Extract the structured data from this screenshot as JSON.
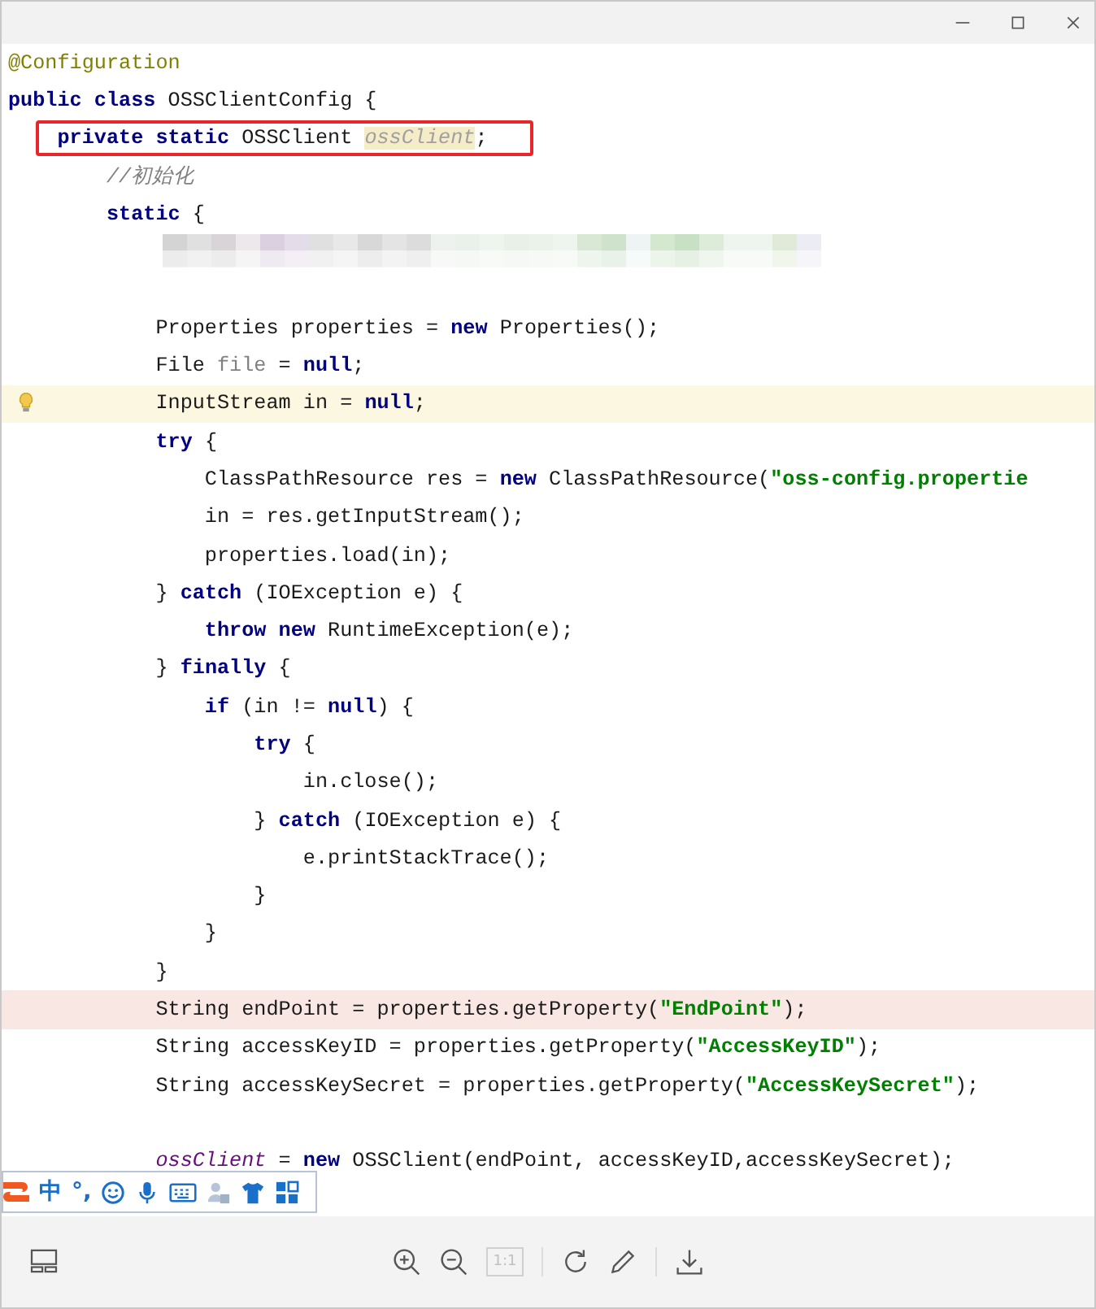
{
  "code_lines": [
    {
      "kind": "code",
      "caret_line": false,
      "error_line": false,
      "boxed": false,
      "bulb": false,
      "tokens": [
        {
          "kind": "annotation",
          "text": "@Configuration"
        }
      ]
    },
    {
      "kind": "code",
      "caret_line": false,
      "error_line": false,
      "boxed": false,
      "bulb": false,
      "tokens": [
        {
          "kind": "keyword",
          "text": "public class"
        },
        {
          "kind": "plain",
          "text": " OSSClientConfig {"
        }
      ]
    },
    {
      "kind": "code",
      "caret_line": false,
      "error_line": false,
      "boxed": true,
      "bulb": false,
      "tokens": [
        {
          "kind": "keyword",
          "text": "    private static"
        },
        {
          "kind": "plain",
          "text": " OSSClient "
        },
        {
          "kind": "unused_field",
          "text": "ossClient"
        },
        {
          "kind": "plain",
          "text": ";"
        }
      ]
    },
    {
      "kind": "code",
      "caret_line": false,
      "error_line": false,
      "boxed": false,
      "bulb": false,
      "tokens": [
        {
          "kind": "comment",
          "text": "        //初始化"
        }
      ]
    },
    {
      "kind": "code",
      "caret_line": false,
      "error_line": false,
      "boxed": false,
      "bulb": false,
      "tokens": [
        {
          "kind": "keyword",
          "text": "        static"
        },
        {
          "kind": "plain",
          "text": " {"
        }
      ]
    },
    {
      "kind": "blurred",
      "caret_line": false,
      "error_line": false,
      "boxed": false,
      "bulb": false
    },
    {
      "kind": "blank",
      "caret_line": false,
      "error_line": false,
      "boxed": false,
      "bulb": false
    },
    {
      "kind": "code",
      "caret_line": false,
      "error_line": false,
      "boxed": false,
      "bulb": false,
      "tokens": [
        {
          "kind": "plain",
          "text": "            Properties properties = "
        },
        {
          "kind": "keyword",
          "text": "new"
        },
        {
          "kind": "plain",
          "text": " Properties();"
        }
      ]
    },
    {
      "kind": "code",
      "caret_line": false,
      "error_line": false,
      "boxed": false,
      "bulb": false,
      "tokens": [
        {
          "kind": "plain",
          "text": "            File "
        },
        {
          "kind": "unused",
          "text": "file"
        },
        {
          "kind": "plain",
          "text": " = "
        },
        {
          "kind": "keyword",
          "text": "null"
        },
        {
          "kind": "plain",
          "text": ";"
        }
      ]
    },
    {
      "kind": "code",
      "caret_line": true,
      "error_line": false,
      "boxed": false,
      "bulb": true,
      "tokens": [
        {
          "kind": "plain",
          "text": "            InputStream in = "
        },
        {
          "kind": "keyword",
          "text": "null"
        },
        {
          "kind": "plain",
          "text": ";"
        }
      ]
    },
    {
      "kind": "code",
      "caret_line": false,
      "error_line": false,
      "boxed": false,
      "bulb": false,
      "tokens": [
        {
          "kind": "keyword",
          "text": "            try"
        },
        {
          "kind": "plain",
          "text": " {"
        }
      ]
    },
    {
      "kind": "code",
      "caret_line": false,
      "error_line": false,
      "boxed": false,
      "bulb": false,
      "tokens": [
        {
          "kind": "plain",
          "text": "                ClassPathResource res = "
        },
        {
          "kind": "keyword",
          "text": "new"
        },
        {
          "kind": "plain",
          "text": " ClassPathResource("
        },
        {
          "kind": "string",
          "text": "\"oss-config.propertie"
        }
      ]
    },
    {
      "kind": "code",
      "caret_line": false,
      "error_line": false,
      "boxed": false,
      "bulb": false,
      "tokens": [
        {
          "kind": "plain",
          "text": "                in = res.getInputStream();"
        }
      ]
    },
    {
      "kind": "code",
      "caret_line": false,
      "error_line": false,
      "boxed": false,
      "bulb": false,
      "tokens": [
        {
          "kind": "plain",
          "text": "                properties.load(in);"
        }
      ]
    },
    {
      "kind": "code",
      "caret_line": false,
      "error_line": false,
      "boxed": false,
      "bulb": false,
      "tokens": [
        {
          "kind": "plain",
          "text": "            } "
        },
        {
          "kind": "keyword",
          "text": "catch"
        },
        {
          "kind": "plain",
          "text": " (IOException e) {"
        }
      ]
    },
    {
      "kind": "code",
      "caret_line": false,
      "error_line": false,
      "boxed": false,
      "bulb": false,
      "tokens": [
        {
          "kind": "keyword",
          "text": "                throw new"
        },
        {
          "kind": "plain",
          "text": " RuntimeException(e);"
        }
      ]
    },
    {
      "kind": "code",
      "caret_line": false,
      "error_line": false,
      "boxed": false,
      "bulb": false,
      "tokens": [
        {
          "kind": "plain",
          "text": "            } "
        },
        {
          "kind": "keyword",
          "text": "finally"
        },
        {
          "kind": "plain",
          "text": " {"
        }
      ]
    },
    {
      "kind": "code",
      "caret_line": false,
      "error_line": false,
      "boxed": false,
      "bulb": false,
      "tokens": [
        {
          "kind": "keyword",
          "text": "                if"
        },
        {
          "kind": "plain",
          "text": " (in != "
        },
        {
          "kind": "keyword",
          "text": "null"
        },
        {
          "kind": "plain",
          "text": ") {"
        }
      ]
    },
    {
      "kind": "code",
      "caret_line": false,
      "error_line": false,
      "boxed": false,
      "bulb": false,
      "tokens": [
        {
          "kind": "keyword",
          "text": "                    try"
        },
        {
          "kind": "plain",
          "text": " {"
        }
      ]
    },
    {
      "kind": "code",
      "caret_line": false,
      "error_line": false,
      "boxed": false,
      "bulb": false,
      "tokens": [
        {
          "kind": "plain",
          "text": "                        in.close();"
        }
      ]
    },
    {
      "kind": "code",
      "caret_line": false,
      "error_line": false,
      "boxed": false,
      "bulb": false,
      "tokens": [
        {
          "kind": "plain",
          "text": "                    } "
        },
        {
          "kind": "keyword",
          "text": "catch"
        },
        {
          "kind": "plain",
          "text": " (IOException e) {"
        }
      ]
    },
    {
      "kind": "code",
      "caret_line": false,
      "error_line": false,
      "boxed": false,
      "bulb": false,
      "tokens": [
        {
          "kind": "plain",
          "text": "                        e.printStackTrace();"
        }
      ]
    },
    {
      "kind": "code",
      "caret_line": false,
      "error_line": false,
      "boxed": false,
      "bulb": false,
      "tokens": [
        {
          "kind": "plain",
          "text": "                    }"
        }
      ]
    },
    {
      "kind": "code",
      "caret_line": false,
      "error_line": false,
      "boxed": false,
      "bulb": false,
      "tokens": [
        {
          "kind": "plain",
          "text": "                }"
        }
      ]
    },
    {
      "kind": "code",
      "caret_line": false,
      "error_line": false,
      "boxed": false,
      "bulb": false,
      "tokens": [
        {
          "kind": "plain",
          "text": "            }"
        }
      ]
    },
    {
      "kind": "code",
      "caret_line": false,
      "error_line": true,
      "boxed": false,
      "bulb": false,
      "tokens": [
        {
          "kind": "plain",
          "text": "            String endPoint = properties.getProperty("
        },
        {
          "kind": "string",
          "text": "\"EndPoint\""
        },
        {
          "kind": "plain",
          "text": ");"
        }
      ]
    },
    {
      "kind": "code",
      "caret_line": false,
      "error_line": false,
      "boxed": false,
      "bulb": false,
      "tokens": [
        {
          "kind": "plain",
          "text": "            String accessKeyID = properties.getProperty("
        },
        {
          "kind": "string",
          "text": "\"AccessKeyID\""
        },
        {
          "kind": "plain",
          "text": ");"
        }
      ]
    },
    {
      "kind": "code",
      "caret_line": false,
      "error_line": false,
      "boxed": false,
      "bulb": false,
      "tokens": [
        {
          "kind": "plain",
          "text": "            String accessKeySecret = properties.getProperty("
        },
        {
          "kind": "string",
          "text": "\"AccessKeySecret\""
        },
        {
          "kind": "plain",
          "text": ");"
        }
      ]
    },
    {
      "kind": "blank",
      "caret_line": false,
      "error_line": false,
      "boxed": false,
      "bulb": false
    },
    {
      "kind": "code",
      "caret_line": false,
      "error_line": false,
      "boxed": false,
      "bulb": false,
      "tokens": [
        {
          "kind": "field",
          "text": "            ossClient"
        },
        {
          "kind": "plain",
          "text": " = "
        },
        {
          "kind": "keyword",
          "text": "new"
        },
        {
          "kind": "plain",
          "text": " OSSClient(endPoint, accessKeyID,accessKeySecret);"
        }
      ]
    }
  ],
  "ime_bar": {
    "mode": "中",
    "punctuation": "°,"
  },
  "toolbar": {
    "actual_size": {
      "label": "1:1",
      "disabled": true
    }
  }
}
